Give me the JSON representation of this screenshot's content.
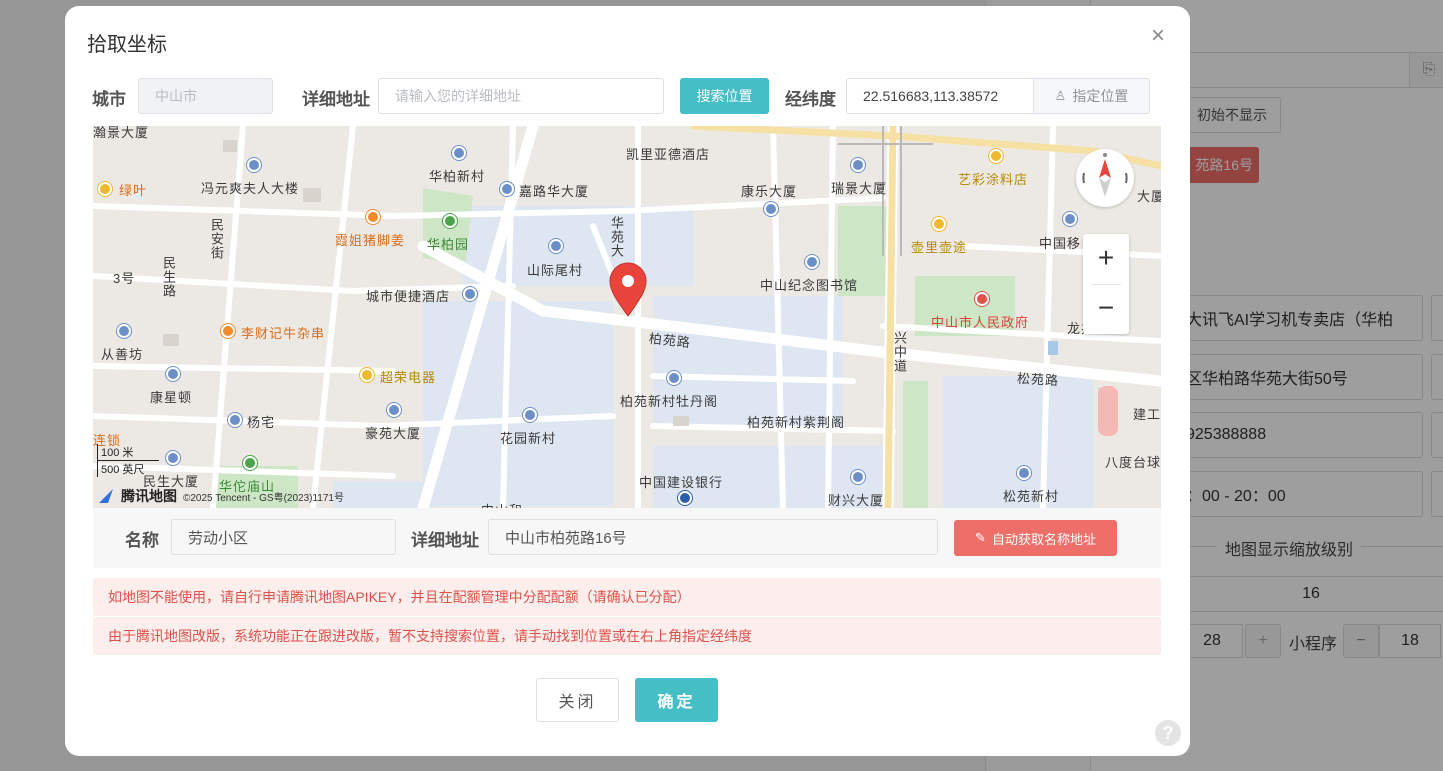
{
  "background": {
    "btn_initial_hide": "初始不显示",
    "btn_address": "苑路16号",
    "field_shop_name": "大讯飞AI学习机专卖店（华柏",
    "field_address": "区华柏路华苑大街50号",
    "field_phone": "925388888",
    "field_hours": "：00 - 20：00",
    "zoom_section_label": "地图显示缩放级别",
    "zoom_value": "16",
    "stepper_value_a": "28",
    "stepper_plus": "+",
    "mini_program_label": "小程序",
    "stepper_minus": "−",
    "stepper_value_b": "18"
  },
  "modal": {
    "title": "拾取坐标",
    "close": "×",
    "city_label": "城市",
    "city_value": "中山市",
    "detail_label": "详细地址",
    "detail_placeholder": "请输入您的详细地址",
    "search_button": "搜索位置",
    "latlng_label": "经纬度",
    "latlng_value": "22.516683,113.38572",
    "assign_button": "指定位置",
    "name_label": "名称",
    "name_value": "劳动小区",
    "address_label": "详细地址",
    "address_value": "中山市柏苑路16号",
    "auto_button": "自动获取名称地址",
    "alert_1": "如地图不能使用，请自行申请腾讯地图APIKEY，并且在配额管理中分配配额（请确认已分配）",
    "alert_2": "由于腾讯地图改版，系统功能正在跟进改版，暂不支持搜索位置，请手动找到位置或在右上角指定经纬度",
    "cancel_button": "关闭",
    "confirm_button": "确定",
    "help": "?"
  },
  "map": {
    "zoom_in": "+",
    "zoom_out": "−",
    "scale_metric": "100 米",
    "scale_imperial": "500 英尺",
    "brand": "腾讯地图",
    "copyright": "©2025 Tencent - GS粤(2023)1171号",
    "labels": {
      "p01": "绿叶",
      "p02": "冯元爽夫人大楼",
      "p03": "华柏新村",
      "p04": "嘉路华大厦",
      "p05": "凯里亚德酒店",
      "p06": "康乐大厦",
      "p07": "瑞景大厦",
      "p08": "艺彩涂料店",
      "p09": "霞姐猪脚姜",
      "p10": "华柏园",
      "p11": "民安街",
      "p12": "华苑大",
      "p13": "山际尾村",
      "p14": "壶里壶途",
      "p15": "中国移",
      "p16": "中山纪念图书馆",
      "p17": "3号",
      "p18": "民生路",
      "p19": "城市便捷酒店",
      "p20": "中山市人民政府",
      "p21": "李财记牛杂串",
      "p22": "柏苑路",
      "p23": "兴中道",
      "p24": "龙井小区",
      "p25": "从善坊",
      "p26": "超荣电器",
      "p27": "松苑路",
      "p28": "康星顿",
      "p29": "柏苑新村牡丹阁",
      "p30": "杨宅",
      "p31": "豪苑大厦",
      "p32": "花园新村",
      "p33": "柏苑新村紫荆阁",
      "p34": "建工",
      "p35": "连锁",
      "p36": "八度台球",
      "p37": "民生大厦",
      "p38": "华佗庙山",
      "p39": "中国建设银行",
      "p40": "松苑新村",
      "p41": "财兴大厦",
      "p42": "中山和",
      "p43": "大厦",
      "p44": "瀚景大厦"
    }
  },
  "colors": {
    "teal": "#45bec5",
    "red_button": "#ee6f6a",
    "alert_bg": "#fdeeee",
    "alert_text": "#e0514a",
    "marker": "#e8443b"
  }
}
